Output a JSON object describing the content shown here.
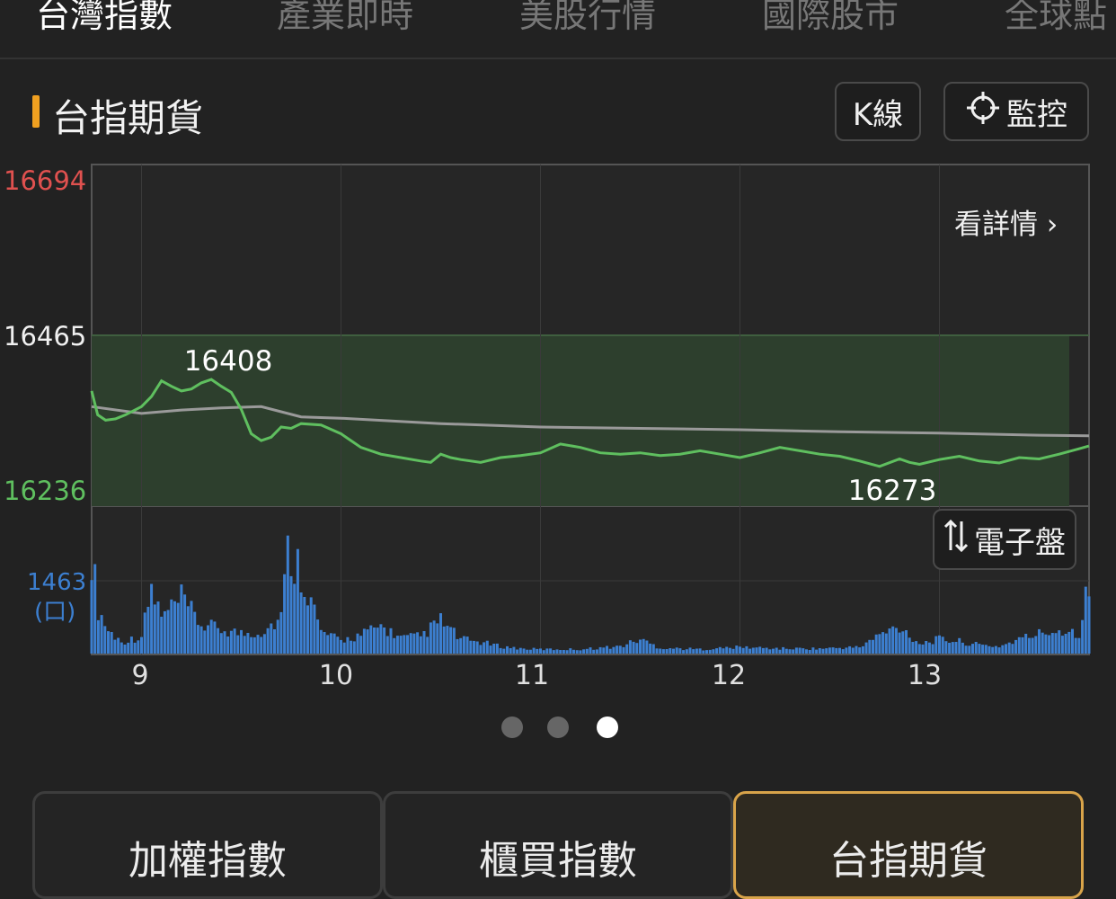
{
  "top_tabs": [
    "台灣指數",
    "產業即時",
    "美股行情",
    "國際股市",
    "全球點"
  ],
  "active_tab": 0,
  "section": {
    "title": "台指期貨"
  },
  "buttons": {
    "kline": "K線",
    "monitor": "監控",
    "detail": "看詳情",
    "electronic": "電子盤"
  },
  "colors": {
    "accent": "#f0a020",
    "up": "#e0514f",
    "down": "#5fbf5f",
    "volume": "#3c7fd0",
    "selected_border": "#d9a44a"
  },
  "chart_data": {
    "type": "line",
    "x_axis": {
      "ticks": [
        "9",
        "10",
        "11",
        "12",
        "13"
      ],
      "range": [
        8.75,
        13.75
      ]
    },
    "price": {
      "high_label": "16694",
      "ref_label": "16465",
      "low_label": "16236",
      "ylim": [
        16236,
        16694
      ],
      "reference": 16465,
      "annotation_high": "16408",
      "annotation_low": "16273",
      "series": [
        {
          "name": "price",
          "x": [
            8.75,
            8.78,
            8.82,
            8.87,
            8.92,
            9.0,
            9.05,
            9.1,
            9.15,
            9.2,
            9.25,
            9.3,
            9.35,
            9.4,
            9.45,
            9.5,
            9.55,
            9.6,
            9.65,
            9.7,
            9.75,
            9.8,
            9.9,
            10.0,
            10.05,
            10.1,
            10.2,
            10.3,
            10.4,
            10.45,
            10.5,
            10.55,
            10.6,
            10.7,
            10.8,
            10.9,
            11.0,
            11.1,
            11.2,
            11.3,
            11.4,
            11.5,
            11.6,
            11.7,
            11.8,
            11.9,
            12.0,
            12.1,
            12.2,
            12.3,
            12.4,
            12.5,
            12.6,
            12.7,
            12.8,
            12.85,
            12.9,
            13.0,
            13.1,
            13.2,
            13.3,
            13.4,
            13.5,
            13.6,
            13.7,
            13.75
          ],
          "y": [
            16383,
            16348,
            16340,
            16342,
            16348,
            16360,
            16375,
            16398,
            16390,
            16383,
            16386,
            16395,
            16400,
            16390,
            16381,
            16356,
            16320,
            16310,
            16315,
            16330,
            16328,
            16335,
            16333,
            16320,
            16310,
            16300,
            16290,
            16285,
            16280,
            16278,
            16290,
            16285,
            16282,
            16278,
            16285,
            16288,
            16292,
            16305,
            16300,
            16292,
            16290,
            16292,
            16288,
            16290,
            16295,
            16290,
            16285,
            16292,
            16300,
            16295,
            16290,
            16287,
            16280,
            16272,
            16283,
            16278,
            16275,
            16282,
            16287,
            16280,
            16277,
            16285,
            16283,
            16290,
            16298,
            16302
          ]
        },
        {
          "name": "average",
          "x": [
            8.75,
            9.0,
            9.2,
            9.4,
            9.6,
            9.8,
            10.0,
            10.5,
            11.0,
            11.5,
            12.0,
            12.5,
            13.0,
            13.5,
            13.75
          ],
          "y": [
            16360,
            16350,
            16355,
            16358,
            16360,
            16345,
            16343,
            16335,
            16330,
            16328,
            16326,
            16323,
            16321,
            16318,
            16317
          ]
        }
      ]
    },
    "volume": {
      "label": "1463",
      "unit": "(口)",
      "max": 1463,
      "x": [
        8.75,
        8.78,
        8.83,
        8.9,
        9.0,
        9.05,
        9.1,
        9.2,
        9.3,
        9.5,
        9.6,
        9.7,
        9.73,
        9.8,
        9.9,
        10.0,
        10.1,
        10.2,
        10.3,
        10.4,
        10.5,
        10.6,
        10.7,
        10.8,
        10.9,
        11.0,
        11.2,
        11.4,
        11.5,
        11.6,
        11.8,
        12.0,
        12.2,
        12.4,
        12.6,
        12.7,
        12.8,
        12.9,
        13.0,
        13.1,
        13.2,
        13.3,
        13.4,
        13.5,
        13.6,
        13.7,
        13.75
      ],
      "y": [
        1450,
        650,
        330,
        160,
        240,
        900,
        500,
        750,
        400,
        280,
        300,
        500,
        1400,
        1190,
        300,
        180,
        260,
        380,
        220,
        240,
        460,
        200,
        160,
        100,
        70,
        60,
        60,
        100,
        200,
        80,
        60,
        90,
        70,
        70,
        90,
        260,
        380,
        140,
        200,
        170,
        120,
        100,
        200,
        280,
        330,
        300,
        1000
      ]
    }
  }
}
